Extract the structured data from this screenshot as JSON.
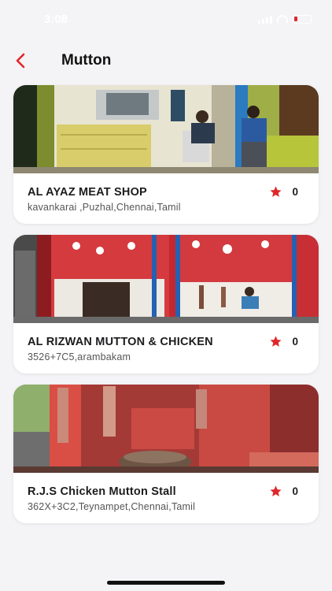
{
  "status_bar": {
    "time": "3:08"
  },
  "header": {
    "title": "Mutton"
  },
  "colors": {
    "accent": "#e0262b",
    "background": "#f4f4f6",
    "card": "#ffffff"
  },
  "shops": [
    {
      "name": "AL AYAZ MEAT SHOP",
      "address": "kavankarai ,Puzhal,Chennai,Tamil",
      "rating": "0"
    },
    {
      "name": "AL RIZWAN MUTTON & CHICKEN",
      "address": "3526+7C5,arambakam",
      "rating": "0"
    },
    {
      "name": "R.J.S Chicken Mutton Stall",
      "address": "362X+3C2,Teynampet,Chennai,Tamil",
      "rating": "0"
    }
  ]
}
